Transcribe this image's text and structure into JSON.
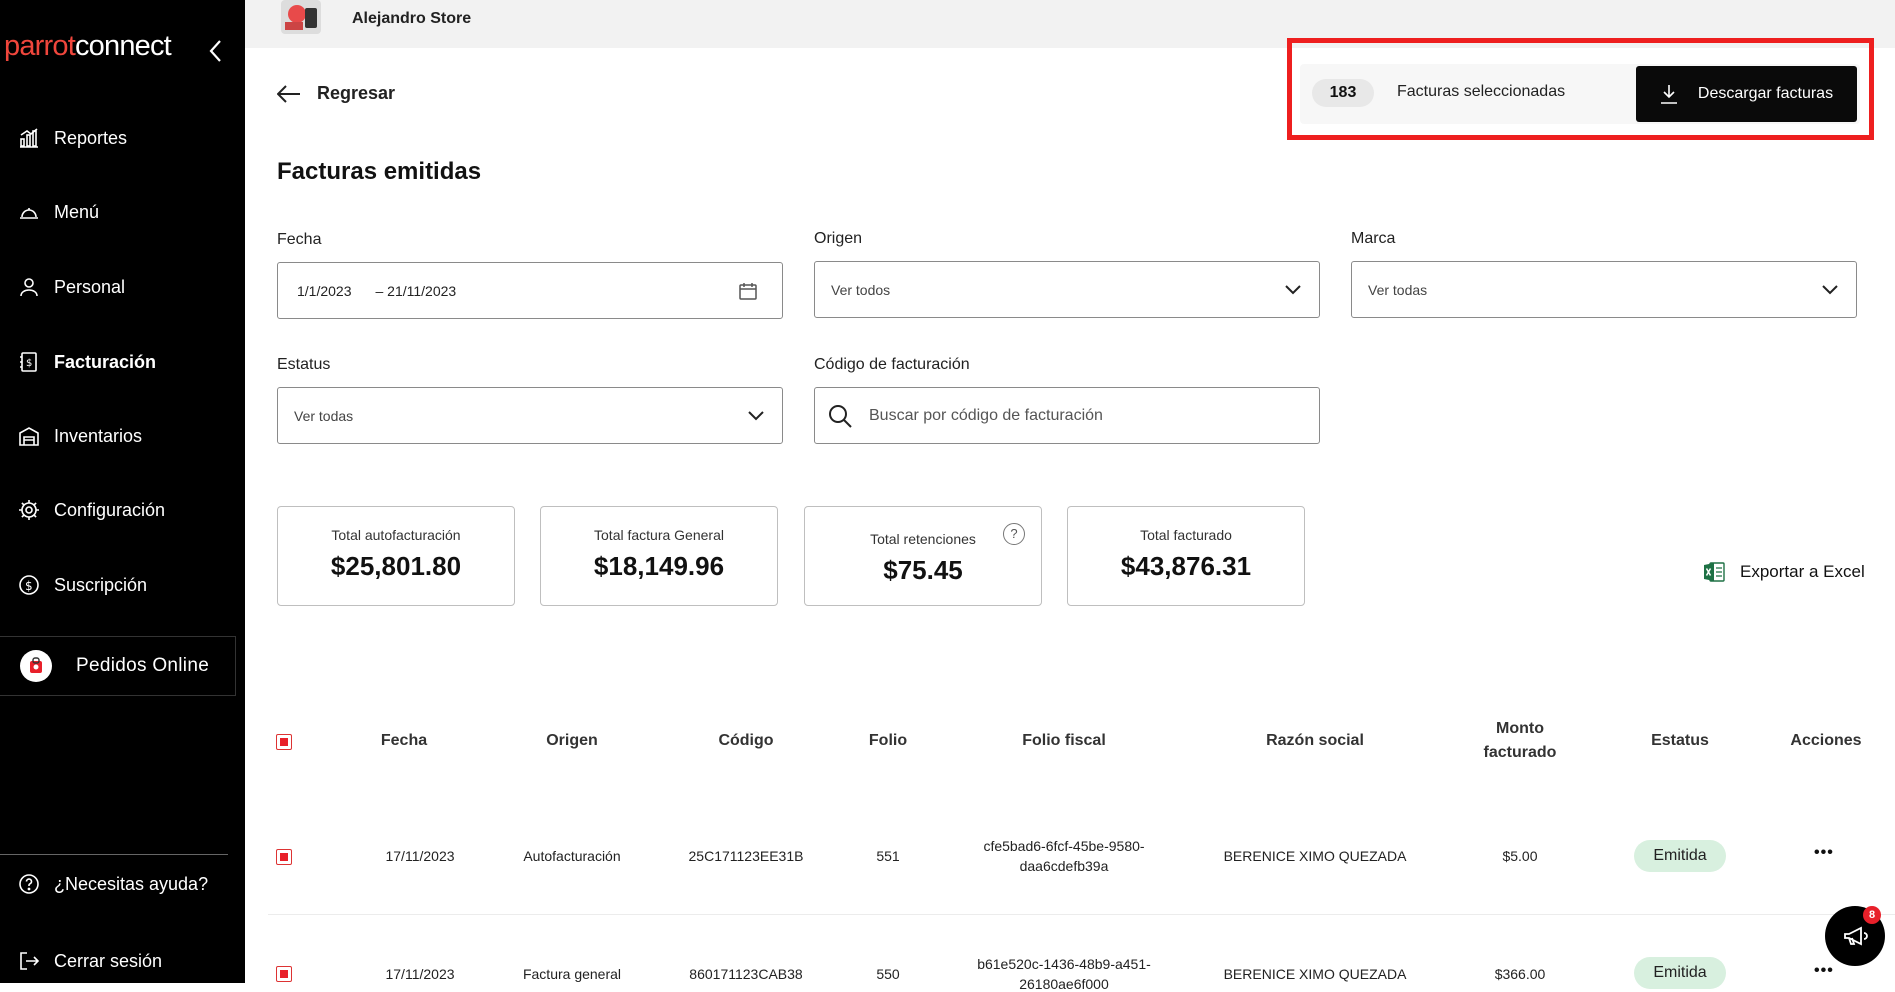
{
  "brand": {
    "part1": "parrot",
    "part2": "connect",
    "accent": "#f0463c"
  },
  "store": {
    "name": "Alejandro Store"
  },
  "sidebar": {
    "items": [
      {
        "label": "Reportes",
        "icon": "chart-bar-icon"
      },
      {
        "label": "Menú",
        "icon": "cloche-icon"
      },
      {
        "label": "Personal",
        "icon": "person-icon"
      },
      {
        "label": "Facturación",
        "icon": "invoice-icon",
        "active": true
      },
      {
        "label": "Inventarios",
        "icon": "warehouse-icon"
      },
      {
        "label": "Configuración",
        "icon": "gear-icon"
      },
      {
        "label": "Suscripción",
        "icon": "dollar-circle-icon"
      }
    ],
    "online_orders": "Pedidos Online",
    "help": "¿Necesitas ayuda?",
    "logout": "Cerrar sesión"
  },
  "header": {
    "back_label": "Regresar",
    "title": "Facturas emitidas"
  },
  "selection": {
    "count": "183",
    "label": "Facturas seleccionadas",
    "download_label": "Descargar facturas",
    "highlight_color": "#ee1f1f"
  },
  "filters": {
    "date": {
      "label": "Fecha",
      "from": "1/1/2023",
      "to": "– 21/11/2023"
    },
    "origin": {
      "label": "Origen",
      "value": "Ver todos"
    },
    "brand": {
      "label": "Marca",
      "value": "Ver todas"
    },
    "status": {
      "label": "Estatus",
      "value": "Ver todas"
    },
    "code": {
      "label": "Código de facturación",
      "placeholder": "Buscar por código de facturación"
    }
  },
  "totals": [
    {
      "title": "Total autofacturación",
      "value": "$25,801.80"
    },
    {
      "title": "Total factura General",
      "value": "$18,149.96"
    },
    {
      "title": "Total retenciones",
      "value": "$75.45",
      "help": "?"
    },
    {
      "title": "Total facturado",
      "value": "$43,876.31"
    }
  ],
  "export_label": "Exportar a Excel",
  "table": {
    "headers": [
      "Fecha",
      "Origen",
      "Código",
      "Folio",
      "Folio fiscal",
      "Razón social",
      "Monto",
      "facturado",
      "Estatus",
      "Acciones"
    ],
    "rows": [
      {
        "fecha": "17/11/2023",
        "origen": "Autofacturación",
        "codigo": "25C171123EE31B",
        "folio": "551",
        "folio_fiscal_1": "cfe5bad6-6fcf-45be-9580-",
        "folio_fiscal_2": "daa6cdefb39a",
        "razon": "BERENICE XIMO QUEZADA",
        "monto": "$5.00",
        "estatus": "Emitida",
        "acciones": "•••"
      },
      {
        "fecha": "17/11/2023",
        "origen": "Factura general",
        "codigo": "860171123CAB38",
        "folio": "550",
        "folio_fiscal_1": "b61e520c-1436-48b9-a451-",
        "folio_fiscal_2": "26180ae6f000",
        "razon": "BERENICE XIMO QUEZADA",
        "monto": "$366.00",
        "estatus": "Emitida",
        "acciones": "•••"
      }
    ]
  },
  "notifications": {
    "count": "8"
  }
}
